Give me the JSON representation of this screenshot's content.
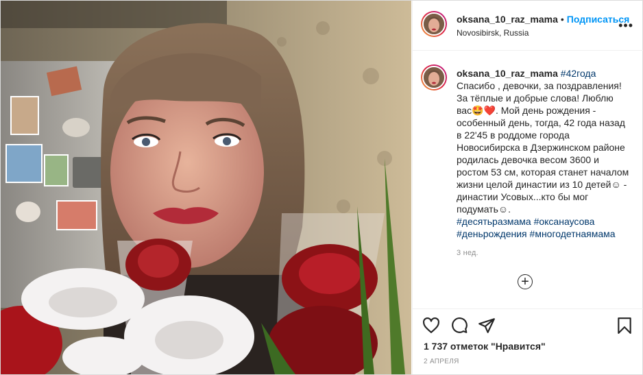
{
  "header": {
    "username": "oksana_10_raz_mama",
    "follow_label": "Подписаться",
    "separator": "•",
    "location": "Novosibirsk, Russia",
    "more_label": "•••"
  },
  "caption": {
    "username": "oksana_10_raz_mama",
    "tag_age": "#42года",
    "text_1": "Спасибо , девочки, за поздравления! За тёплые и добрые слова! Люблю вас",
    "emoji_1": "🤩",
    "emoji_2": "❤️",
    "text_2": ". Мой день рождения - особенный день, тогда, 42 года назад в 22'45 в роддоме города Новосибирска в Дзержинском районе родилась девочка весом 3600 и ростом 53 см, которая станет началом жизни целой династии из 10 детей☺ - династии Усовых...кто бы мог подумать☺.",
    "hashtags": [
      "#десятьразмама",
      "#оксанаусова",
      "#деньрождения",
      "#многодетнаямама"
    ],
    "time_ago": "3 нед."
  },
  "load_more_icon": "+",
  "icons": {
    "like": "heart-icon",
    "comment": "comment-icon",
    "share": "share-icon",
    "save": "bookmark-icon"
  },
  "likes_text": "1 737 отметок \"Нравится\"",
  "date_text": "2 АПРЕЛЯ",
  "colors": {
    "follow": "#0095f6",
    "hashtag": "#00376b",
    "muted": "#8e8e8e"
  }
}
